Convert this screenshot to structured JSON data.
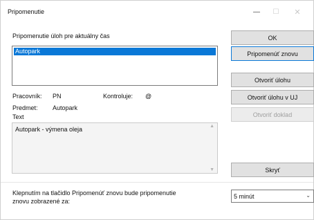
{
  "window": {
    "title": "Pripomenutie",
    "min_glyph": "—",
    "max_glyph": "☐",
    "close_glyph": "✕"
  },
  "main": {
    "heading": "Pripomenutie úloh pre aktuálny čas",
    "list_items": [
      "Autopark"
    ],
    "worker_label": "Pracovník:",
    "worker_value": "PN",
    "checker_label": "Kontroluje:",
    "checker_value": "@",
    "subject_label": "Predmet:",
    "subject_value": "Autopark",
    "text_label": "Text",
    "text_value": "Autopark - výmena oleja"
  },
  "buttons": {
    "ok": "OK",
    "remind_again": "Pripomenúť znovu",
    "open_task": "Otvoriť úlohu",
    "open_task_uj": "Otvoriť úlohu v UJ",
    "open_document": "Otvoriť doklad",
    "hide": "Skryť"
  },
  "footer": {
    "note_line1": "Klepnutím na tlačidlo Pripomenúť znovu bude pripomenutie",
    "note_line2": "znovu zobrazené za:",
    "interval_value": "5 minút"
  }
}
